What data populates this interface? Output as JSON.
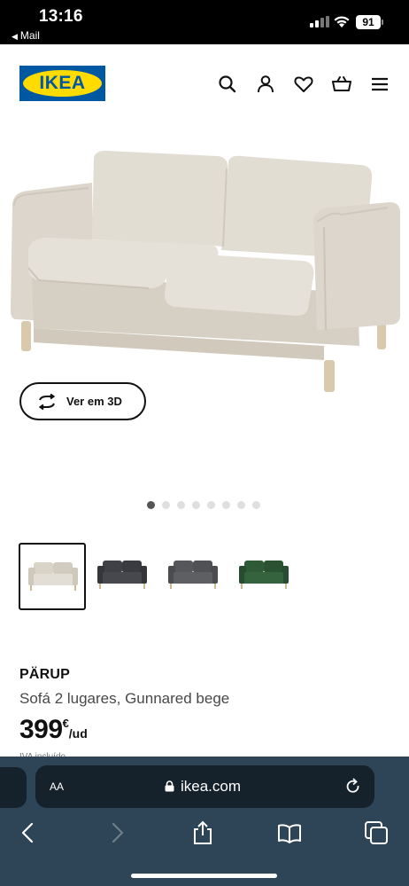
{
  "status_bar": {
    "time": "13:16",
    "back_app": "Mail",
    "battery": "91"
  },
  "header": {
    "logo_text": "IKEA",
    "icons": [
      "search-icon",
      "user-icon",
      "heart-icon",
      "cart-icon",
      "menu-icon"
    ]
  },
  "hero": {
    "ver_3d_label": "Ver em 3D",
    "carousel_count": 8,
    "carousel_active": 1
  },
  "thumbnails": [
    {
      "color": "#d9d3c8",
      "selected": true
    },
    {
      "color": "#3f4146",
      "selected": false
    },
    {
      "color": "#55575b",
      "selected": false
    },
    {
      "color": "#2f5a37",
      "selected": false
    }
  ],
  "product": {
    "name": "PÄRUP",
    "description": "Sofá 2 lugares, Gunnared bege",
    "price_integer": "399",
    "price_currency": "€",
    "price_unit": "/ud",
    "partial_text": "IVA incluído"
  },
  "browser": {
    "text_size_label": "AA",
    "url": "ikea.com"
  },
  "colors": {
    "ikea_blue": "#0058a3",
    "ikea_yellow": "#ffdb00",
    "safari_bar": "#2d4556"
  }
}
